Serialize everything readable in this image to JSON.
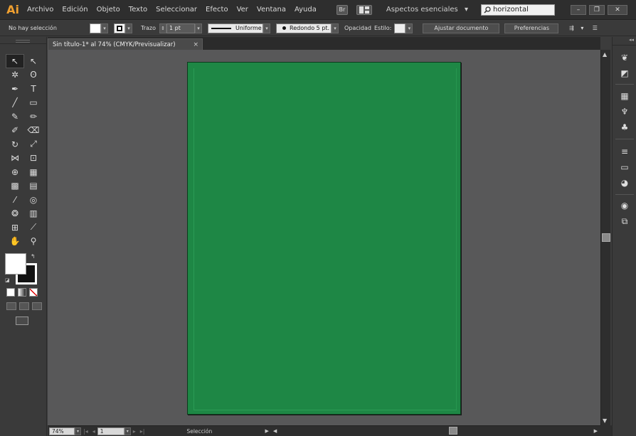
{
  "app": {
    "logo": "Ai"
  },
  "menu": [
    "Archivo",
    "Edición",
    "Objeto",
    "Texto",
    "Seleccionar",
    "Efecto",
    "Ver",
    "Ventana",
    "Ayuda"
  ],
  "menubar": {
    "bridge_icon": "Br",
    "workspace_label": "Aspectos esenciales",
    "workspace_arrow": "▾",
    "search_value": "horizontal",
    "window_buttons": [
      "–",
      "❐",
      "✕"
    ]
  },
  "controlbar": {
    "selection_status": "No hay selección",
    "stroke_label": "Trazo",
    "stroke_weight": "1 pt",
    "stroke_profile": "Uniforme",
    "brush": "Redondo 5 pt.",
    "opacity_label": "Opacidad",
    "style_label": "Estilo:",
    "fit_document_button": "Ajustar documento",
    "preferences_button": "Preferencias"
  },
  "document": {
    "tab_title": "Sin título-1* al 74% (CMYK/Previsualizar)",
    "tab_close": "×",
    "artboard_color": "#1e8745"
  },
  "tools": [
    {
      "name": "selection-tool",
      "glyph": "↖",
      "selected": true
    },
    {
      "name": "direct-selection-tool",
      "glyph": "↖"
    },
    {
      "name": "magic-wand-tool",
      "glyph": "✲"
    },
    {
      "name": "lasso-tool",
      "glyph": "ʘ"
    },
    {
      "name": "pen-tool",
      "glyph": "✒"
    },
    {
      "name": "type-tool",
      "glyph": "T"
    },
    {
      "name": "line-segment-tool",
      "glyph": "╱"
    },
    {
      "name": "rectangle-tool",
      "glyph": "▭"
    },
    {
      "name": "paintbrush-tool",
      "glyph": "✎"
    },
    {
      "name": "pencil-tool",
      "glyph": "✏"
    },
    {
      "name": "blob-brush-tool",
      "glyph": "✐"
    },
    {
      "name": "eraser-tool",
      "glyph": "⌫"
    },
    {
      "name": "rotate-tool",
      "glyph": "↻"
    },
    {
      "name": "scale-tool",
      "glyph": "⤢"
    },
    {
      "name": "width-tool",
      "glyph": "⋈"
    },
    {
      "name": "free-transform-tool",
      "glyph": "⊡"
    },
    {
      "name": "shape-builder-tool",
      "glyph": "⊕"
    },
    {
      "name": "perspective-grid-tool",
      "glyph": "▦"
    },
    {
      "name": "mesh-tool",
      "glyph": "▩"
    },
    {
      "name": "gradient-tool",
      "glyph": "▤"
    },
    {
      "name": "eyedropper-tool",
      "glyph": "⁄"
    },
    {
      "name": "blend-tool",
      "glyph": "◎"
    },
    {
      "name": "symbol-sprayer-tool",
      "glyph": "❂"
    },
    {
      "name": "column-graph-tool",
      "glyph": "▥"
    },
    {
      "name": "artboard-tool",
      "glyph": "⊞"
    },
    {
      "name": "slice-tool",
      "glyph": "⟋"
    },
    {
      "name": "hand-tool",
      "glyph": "✋"
    },
    {
      "name": "zoom-tool",
      "glyph": "⚲"
    }
  ],
  "colors": {
    "fill": "#ffffff",
    "stroke": "#111111",
    "accent_orange": "#e48a2a"
  },
  "statusbar": {
    "zoom": "74%",
    "artboard_number": "1",
    "tool_status": "Selección",
    "arrow": "▾"
  },
  "right_dock_icons": [
    "color-guide-icon",
    "color-icon",
    "swatches-icon",
    "brushes-icon",
    "symbols-icon",
    "stroke-icon",
    "gradient-icon",
    "transparency-icon",
    "appearance-icon",
    "graphic-styles-icon"
  ]
}
